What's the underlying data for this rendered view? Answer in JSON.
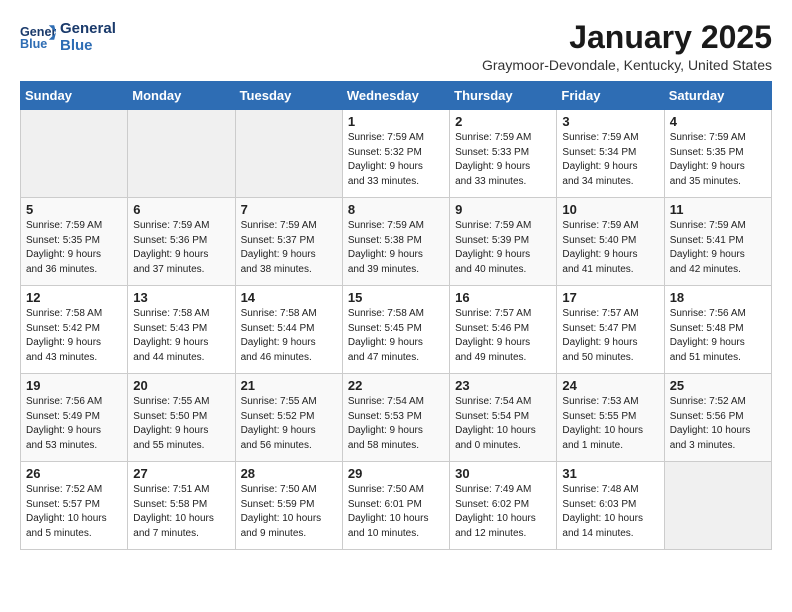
{
  "logo": {
    "line1": "General",
    "line2": "Blue"
  },
  "title": "January 2025",
  "subtitle": "Graymoor-Devondale, Kentucky, United States",
  "weekdays": [
    "Sunday",
    "Monday",
    "Tuesday",
    "Wednesday",
    "Thursday",
    "Friday",
    "Saturday"
  ],
  "weeks": [
    [
      {
        "day": "",
        "info": ""
      },
      {
        "day": "",
        "info": ""
      },
      {
        "day": "",
        "info": ""
      },
      {
        "day": "1",
        "info": "Sunrise: 7:59 AM\nSunset: 5:32 PM\nDaylight: 9 hours\nand 33 minutes."
      },
      {
        "day": "2",
        "info": "Sunrise: 7:59 AM\nSunset: 5:33 PM\nDaylight: 9 hours\nand 33 minutes."
      },
      {
        "day": "3",
        "info": "Sunrise: 7:59 AM\nSunset: 5:34 PM\nDaylight: 9 hours\nand 34 minutes."
      },
      {
        "day": "4",
        "info": "Sunrise: 7:59 AM\nSunset: 5:35 PM\nDaylight: 9 hours\nand 35 minutes."
      }
    ],
    [
      {
        "day": "5",
        "info": "Sunrise: 7:59 AM\nSunset: 5:35 PM\nDaylight: 9 hours\nand 36 minutes."
      },
      {
        "day": "6",
        "info": "Sunrise: 7:59 AM\nSunset: 5:36 PM\nDaylight: 9 hours\nand 37 minutes."
      },
      {
        "day": "7",
        "info": "Sunrise: 7:59 AM\nSunset: 5:37 PM\nDaylight: 9 hours\nand 38 minutes."
      },
      {
        "day": "8",
        "info": "Sunrise: 7:59 AM\nSunset: 5:38 PM\nDaylight: 9 hours\nand 39 minutes."
      },
      {
        "day": "9",
        "info": "Sunrise: 7:59 AM\nSunset: 5:39 PM\nDaylight: 9 hours\nand 40 minutes."
      },
      {
        "day": "10",
        "info": "Sunrise: 7:59 AM\nSunset: 5:40 PM\nDaylight: 9 hours\nand 41 minutes."
      },
      {
        "day": "11",
        "info": "Sunrise: 7:59 AM\nSunset: 5:41 PM\nDaylight: 9 hours\nand 42 minutes."
      }
    ],
    [
      {
        "day": "12",
        "info": "Sunrise: 7:58 AM\nSunset: 5:42 PM\nDaylight: 9 hours\nand 43 minutes."
      },
      {
        "day": "13",
        "info": "Sunrise: 7:58 AM\nSunset: 5:43 PM\nDaylight: 9 hours\nand 44 minutes."
      },
      {
        "day": "14",
        "info": "Sunrise: 7:58 AM\nSunset: 5:44 PM\nDaylight: 9 hours\nand 46 minutes."
      },
      {
        "day": "15",
        "info": "Sunrise: 7:58 AM\nSunset: 5:45 PM\nDaylight: 9 hours\nand 47 minutes."
      },
      {
        "day": "16",
        "info": "Sunrise: 7:57 AM\nSunset: 5:46 PM\nDaylight: 9 hours\nand 49 minutes."
      },
      {
        "day": "17",
        "info": "Sunrise: 7:57 AM\nSunset: 5:47 PM\nDaylight: 9 hours\nand 50 minutes."
      },
      {
        "day": "18",
        "info": "Sunrise: 7:56 AM\nSunset: 5:48 PM\nDaylight: 9 hours\nand 51 minutes."
      }
    ],
    [
      {
        "day": "19",
        "info": "Sunrise: 7:56 AM\nSunset: 5:49 PM\nDaylight: 9 hours\nand 53 minutes."
      },
      {
        "day": "20",
        "info": "Sunrise: 7:55 AM\nSunset: 5:50 PM\nDaylight: 9 hours\nand 55 minutes."
      },
      {
        "day": "21",
        "info": "Sunrise: 7:55 AM\nSunset: 5:52 PM\nDaylight: 9 hours\nand 56 minutes."
      },
      {
        "day": "22",
        "info": "Sunrise: 7:54 AM\nSunset: 5:53 PM\nDaylight: 9 hours\nand 58 minutes."
      },
      {
        "day": "23",
        "info": "Sunrise: 7:54 AM\nSunset: 5:54 PM\nDaylight: 10 hours\nand 0 minutes."
      },
      {
        "day": "24",
        "info": "Sunrise: 7:53 AM\nSunset: 5:55 PM\nDaylight: 10 hours\nand 1 minute."
      },
      {
        "day": "25",
        "info": "Sunrise: 7:52 AM\nSunset: 5:56 PM\nDaylight: 10 hours\nand 3 minutes."
      }
    ],
    [
      {
        "day": "26",
        "info": "Sunrise: 7:52 AM\nSunset: 5:57 PM\nDaylight: 10 hours\nand 5 minutes."
      },
      {
        "day": "27",
        "info": "Sunrise: 7:51 AM\nSunset: 5:58 PM\nDaylight: 10 hours\nand 7 minutes."
      },
      {
        "day": "28",
        "info": "Sunrise: 7:50 AM\nSunset: 5:59 PM\nDaylight: 10 hours\nand 9 minutes."
      },
      {
        "day": "29",
        "info": "Sunrise: 7:50 AM\nSunset: 6:01 PM\nDaylight: 10 hours\nand 10 minutes."
      },
      {
        "day": "30",
        "info": "Sunrise: 7:49 AM\nSunset: 6:02 PM\nDaylight: 10 hours\nand 12 minutes."
      },
      {
        "day": "31",
        "info": "Sunrise: 7:48 AM\nSunset: 6:03 PM\nDaylight: 10 hours\nand 14 minutes."
      },
      {
        "day": "",
        "info": ""
      }
    ]
  ]
}
